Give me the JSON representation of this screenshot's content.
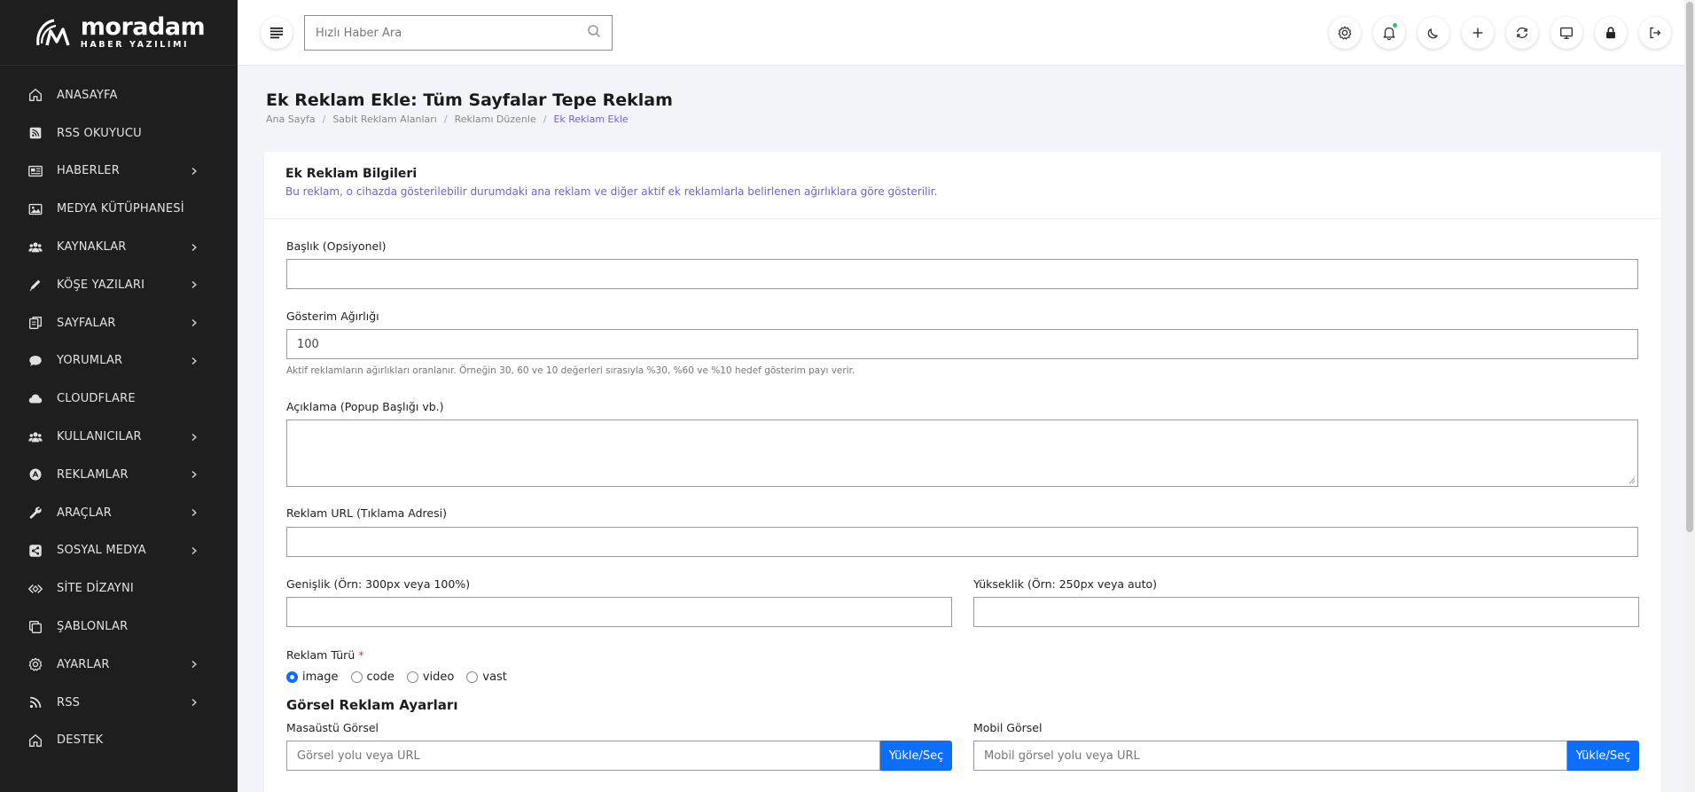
{
  "brand": {
    "name": "moradam",
    "tagline": "HABER YAZILIMI"
  },
  "sidebar": {
    "items": [
      {
        "label": "ANASAYFA",
        "icon": "home-icon",
        "has_children": false
      },
      {
        "label": "RSS OKUYUCU",
        "icon": "rss-square-icon",
        "has_children": false
      },
      {
        "label": "HABERLER",
        "icon": "newspaper-icon",
        "has_children": true
      },
      {
        "label": "MEDYA KÜTÜPHANESİ",
        "icon": "image-icon",
        "has_children": false
      },
      {
        "label": "KAYNAKLAR",
        "icon": "users-icon",
        "has_children": true
      },
      {
        "label": "KÖŞE YAZILARI",
        "icon": "pen-icon",
        "has_children": true
      },
      {
        "label": "SAYFALAR",
        "icon": "pages-icon",
        "has_children": true
      },
      {
        "label": "YORUMLAR",
        "icon": "comment-icon",
        "has_children": true
      },
      {
        "label": "CLOUDFLARE",
        "icon": "cloud-icon",
        "has_children": false
      },
      {
        "label": "KULLANICILAR",
        "icon": "users-icon",
        "has_children": true
      },
      {
        "label": "REKLAMLAR",
        "icon": "ad-icon",
        "has_children": true
      },
      {
        "label": "ARAÇLAR",
        "icon": "wrench-icon",
        "has_children": true
      },
      {
        "label": "SOSYAL MEDYA",
        "icon": "share-icon",
        "has_children": true
      },
      {
        "label": "SİTE DİZAYNI",
        "icon": "code-icon",
        "has_children": false
      },
      {
        "label": "ŞABLONLAR",
        "icon": "copy-icon",
        "has_children": false
      },
      {
        "label": "AYARLAR",
        "icon": "gear-icon",
        "has_children": true
      },
      {
        "label": "RSS",
        "icon": "rss-icon",
        "has_children": true
      },
      {
        "label": "DESTEK",
        "icon": "home-icon",
        "has_children": false
      }
    ]
  },
  "topbar": {
    "search_placeholder": "Hızlı Haber Ara",
    "icons": [
      "gear-icon",
      "bell-icon",
      "moon-icon",
      "plus-icon",
      "sync-icon",
      "monitor-icon",
      "lock-icon",
      "logout-icon"
    ],
    "notification_dot_color": "#28c76f"
  },
  "page": {
    "title": "Ek Reklam Ekle: Tüm Sayfalar Tepe Reklam",
    "breadcrumb": [
      "Ana Sayfa",
      "Sabit Reklam Alanları",
      "Reklamı Düzenle",
      "Ek Reklam Ekle"
    ]
  },
  "card": {
    "title": "Ek Reklam Bilgileri",
    "description": "Bu reklam, o cihazda gösterilebilir durumdaki ana reklam ve diğer aktif ek reklamlarla belirlenen ağırlıklara göre gösterilir."
  },
  "form": {
    "title_label": "Başlık (Opsiyonel)",
    "title_value": "",
    "weight_label": "Gösterim Ağırlığı",
    "weight_value": "100",
    "weight_help": "Aktif reklamların ağırlıkları oranlanır. Örneğin 30, 60 ve 10 değerleri sırasıyla %30, %60 ve %10 hedef gösterim payı verir.",
    "description_label": "Açıklama (Popup Başlığı vb.)",
    "url_label": "Reklam URL (Tıklama Adresi)",
    "width_label": "Genişlik (Örn: 300px veya 100%)",
    "height_label": "Yükseklik (Örn: 250px veya auto)",
    "type_label": "Reklam Türü",
    "required_mark": "*",
    "types": [
      "image",
      "code",
      "video",
      "vast"
    ],
    "selected_type": "image",
    "image_section_title": "Görsel Reklam Ayarları",
    "desktop_image_label": "Masaüstü Görsel",
    "desktop_image_placeholder": "Görsel yolu veya URL",
    "mobile_image_label": "Mobil Görsel",
    "mobile_image_placeholder": "Mobil görsel yolu veya URL",
    "upload_button": "Yükle/Seç"
  },
  "colors": {
    "sidebar_bg": "#1e1e1e",
    "accent": "#6c63d8",
    "primary_button": "#0d6efd",
    "required": "#e53935"
  }
}
